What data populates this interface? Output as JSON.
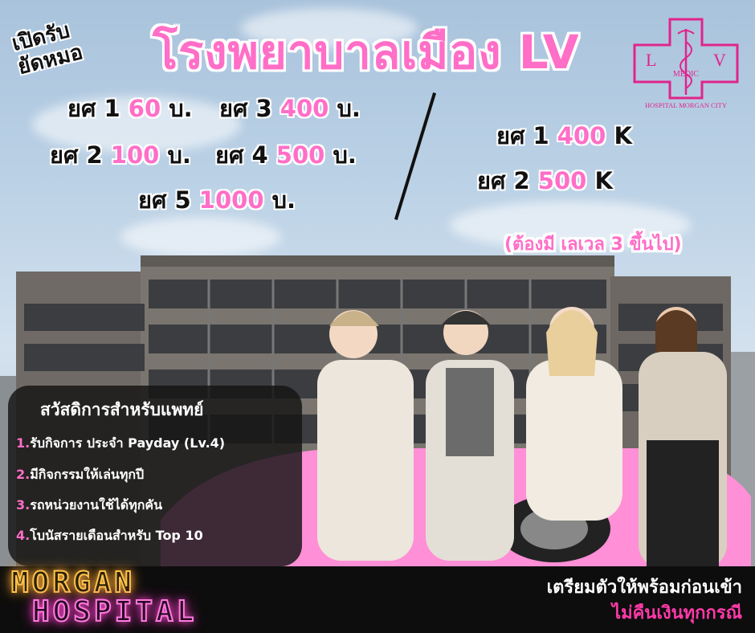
{
  "poster": {
    "title": "โรงพยาบาลเมือง LV",
    "recruit_line1": "เปิดรับ",
    "recruit_line2": "ยัดหมอ"
  },
  "prices_baht": [
    {
      "rank": "ยศ 1",
      "amount": "60",
      "unit": "บ."
    },
    {
      "rank": "ยศ 3",
      "amount": "400",
      "unit": "บ."
    },
    {
      "rank": "ยศ 2",
      "amount": "100",
      "unit": "บ."
    },
    {
      "rank": "ยศ 4",
      "amount": "500",
      "unit": "บ."
    },
    {
      "rank": "ยศ 5",
      "amount": "1000",
      "unit": "บ."
    }
  ],
  "prices_k": [
    {
      "rank": "ยศ 1",
      "amount": "400",
      "unit": "K"
    },
    {
      "rank": "ยศ 2",
      "amount": "500",
      "unit": "K"
    }
  ],
  "requirement": "(ต้องมี เลเวล 3 ขึ้นไป)",
  "logo": {
    "letter_left": "L",
    "letter_right": "V",
    "word": "MEDIC",
    "caption": "HOSPITAL MORGAN CITY"
  },
  "benefits": {
    "heading": "สวัสดิการสำหรับแพทย์",
    "items": [
      {
        "num": "1.",
        "text": "รับกิจการ ประจำ Payday (Lv.4)"
      },
      {
        "num": "2.",
        "text": "มีกิจกรรมให้เล่นทุกปี"
      },
      {
        "num": "3.",
        "text": "รถหน่วยงานใช้ได้ทุกคัน"
      },
      {
        "num": "4.",
        "text": "โบนัสรายเดือนสำหรับ Top 10"
      }
    ]
  },
  "footer": {
    "brand_line1": "MORGAN",
    "brand_line2": "HOSPITAL",
    "note_line1": "เตรียมตัวให้พร้อมก่อนเข้า",
    "note_line2": "ไม่คืนเงินทุกกรณี"
  },
  "colors": {
    "accent_pink": "#ff6ec7",
    "logo_magenta": "#e0248c",
    "neon_orange": "#ffc24b",
    "neon_pink": "#ff7adf",
    "refund_note": "#ff3aa8"
  }
}
